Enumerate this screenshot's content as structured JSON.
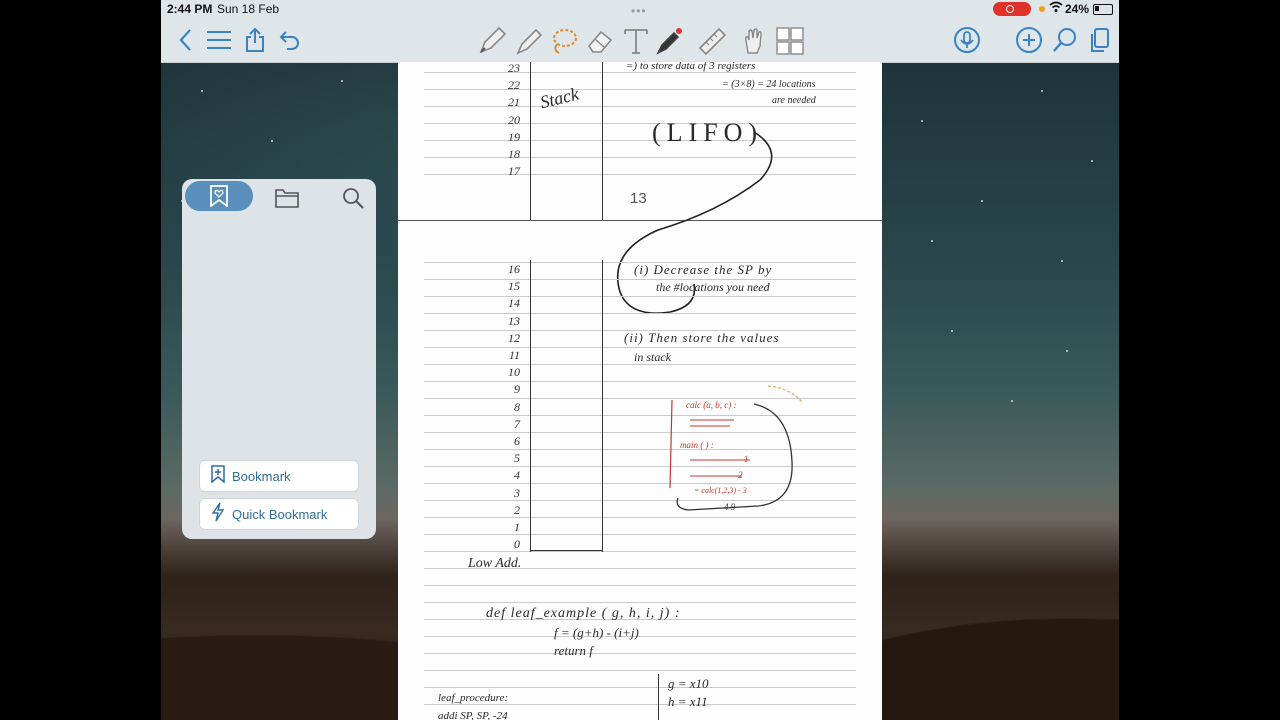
{
  "status_bar": {
    "time": "2:44 PM",
    "date": "Sun 18 Feb",
    "battery": "24%"
  },
  "toolbar": {
    "left_icons": [
      "back-chevron-icon",
      "list-icon",
      "share-icon",
      "undo-icon"
    ],
    "tool_icons": [
      "pen-icon",
      "highlighter-icon",
      "lasso-icon",
      "eraser-icon",
      "text-icon",
      "laser-pointer-icon",
      "ruler-icon",
      "hand-icon",
      "image-grid-icon"
    ],
    "right_icons": [
      "microphone-icon",
      "add-icon",
      "search-icon",
      "pages-icon"
    ],
    "accent": "#3a82c4"
  },
  "bookmark_panel": {
    "tabs": [
      "bookmarks-icon",
      "folder-icon",
      "search-icon"
    ],
    "bookmark_label": "Bookmark",
    "quick_bookmark_label": "Quick Bookmark"
  },
  "page_top": {
    "numbers": [
      "23",
      "22",
      "21",
      "20",
      "19",
      "18",
      "17"
    ],
    "stack_label": "Stack",
    "note_line1": "=) to store data of 3 registers",
    "note_line2": "= (3×8) = 24 locations",
    "note_line3": "are needed",
    "lifo": "(LIFO)",
    "page_number": "13"
  },
  "page_bottom": {
    "numbers": [
      "16",
      "15",
      "14",
      "13",
      "12",
      "11",
      "10",
      "9",
      "8",
      "7",
      "6",
      "5",
      "4",
      "3",
      "2",
      "1",
      "0"
    ],
    "step1_line1": "(i) Decrease the SP by",
    "step1_line2": "the #locations you need",
    "step2_line1": "(ii) Then store the values",
    "step2_line2": "in stack",
    "low_addr": "Low Add.",
    "def_line": "def   leaf_example ( g, h, i, j) :",
    "f_line": "f = (g+h) - (i+j)",
    "return_line": "return f",
    "proc_label": "leaf_procedure:",
    "addi_line": "addi SP, SP, -24",
    "reg_g": "g = x10",
    "reg_h": "h = x11",
    "red_calc": "calc (a, b, c) :",
    "red_main": "main ( ) :",
    "red_1": "1",
    "red_2": "2",
    "red_call": "= calc(1,2,3) - 3",
    "red_nums": "4  9"
  }
}
